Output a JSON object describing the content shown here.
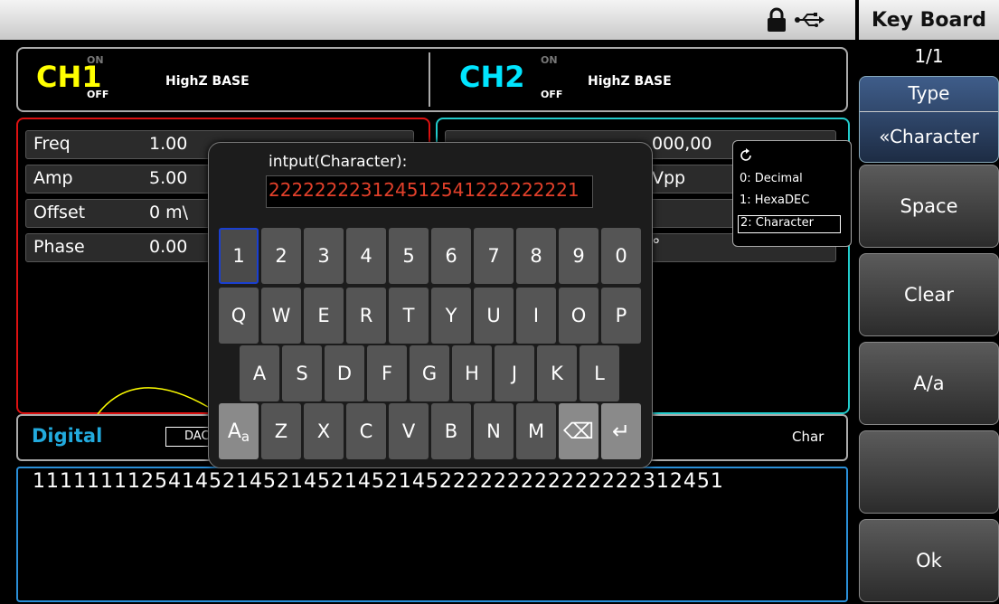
{
  "status_bar": {
    "lock_icon": "lock-icon",
    "usb_icon": "usb-icon"
  },
  "softkeys": {
    "title": "Key Board",
    "page": "1/1",
    "type_label": "Type",
    "type_value": "«Character",
    "space": "Space",
    "clear": "Clear",
    "case": "A/a",
    "ok": "Ok"
  },
  "channels": {
    "ch1": {
      "name": "CH1",
      "on": "ON",
      "off": "OFF",
      "mode": "HighZ  BASE",
      "color": "#ffff00"
    },
    "ch2": {
      "name": "CH2",
      "on": "ON",
      "off": "OFF",
      "mode": "HighZ  BASE",
      "color": "#00e5ff"
    }
  },
  "ch1_params": [
    {
      "label": "Freq",
      "value": "1.00"
    },
    {
      "label": "Amp",
      "value": "5.00"
    },
    {
      "label": "Offset",
      "value": "0 m\\"
    },
    {
      "label": "Phase",
      "value": "0.00"
    }
  ],
  "ch2_params": [
    {
      "value": "000,00"
    },
    {
      "value": "Vpp"
    },
    {
      "value": ""
    },
    {
      "value": "°"
    }
  ],
  "digital": {
    "label": "Digital",
    "dac": "DAC",
    "char": "Char"
  },
  "data_text": "111111112541452145214521452145222222222222222312451",
  "keyboard": {
    "input_label": "intput(Character):",
    "input_value": "222222223124512541222222221",
    "row1": [
      "1",
      "2",
      "3",
      "4",
      "5",
      "6",
      "7",
      "8",
      "9",
      "0"
    ],
    "row2": [
      "Q",
      "W",
      "E",
      "R",
      "T",
      "Y",
      "U",
      "I",
      "O",
      "P"
    ],
    "row3": [
      "A",
      "S",
      "D",
      "F",
      "G",
      "H",
      "J",
      "K",
      "L"
    ],
    "row4": [
      "Aa",
      "Z",
      "X",
      "C",
      "V",
      "B",
      "N",
      "M",
      "⌫",
      "↵"
    ]
  },
  "type_popup": {
    "options": [
      "0: Decimal",
      "1: HexaDEC",
      "2: Character"
    ],
    "selected": "2: Character"
  },
  "colors": {
    "ch1_border": "#dd1111",
    "ch2_border": "#22cccc",
    "input_text": "#e2402a",
    "accent": "#2a8fd8"
  }
}
